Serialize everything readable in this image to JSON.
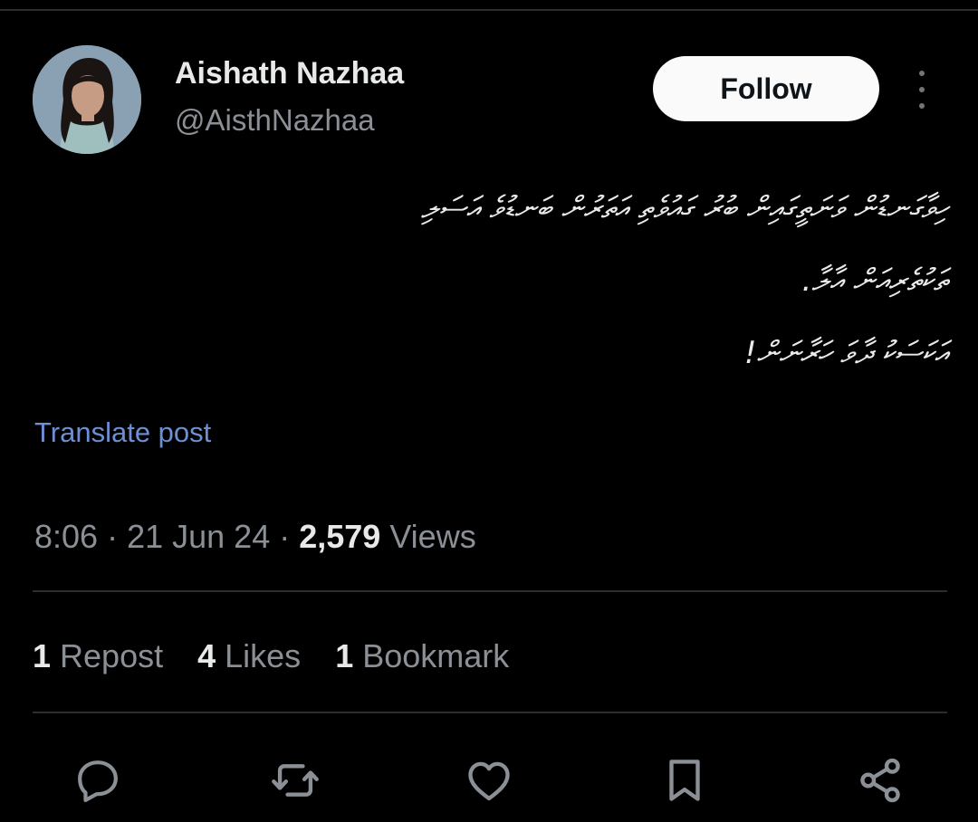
{
  "author": {
    "display_name": "Aishath Nazhaa",
    "handle": "@AisthNazhaa"
  },
  "follow_label": "Follow",
  "post": {
    "lines": [
      "ހިވާގަނޑުން ވަނަތީގައިން ބުރު ގައުވެތި އަތަރުން ބަނޑުވެ އަސަލި",
      "ތަކުތެރިއަން އާލާ.",
      "އަކަސަކު ދާވަ ހަރާނަން!"
    ],
    "translate_label": "Translate post"
  },
  "meta": {
    "time": "8:06",
    "sep1": " · ",
    "date": "21 Jun 24",
    "sep2": " · ",
    "views_count": "2,579",
    "views_label": " Views"
  },
  "stats": {
    "reposts_count": "1",
    "reposts_label": " Repost",
    "likes_count": "4",
    "likes_label": " Likes",
    "bookmarks_count": "1",
    "bookmarks_label": " Bookmark"
  },
  "icons": {
    "reply": "reply-icon",
    "repost": "repost-icon",
    "like": "heart-icon",
    "bookmark": "bookmark-icon",
    "share": "share-icon",
    "more": "more-icon"
  },
  "colors": {
    "background": "#000000",
    "text_primary": "#e7e9ea",
    "text_secondary": "#8b9096",
    "link": "#6d8fd4",
    "follow_bg": "#fafafa",
    "divider": "#2a2d31"
  }
}
